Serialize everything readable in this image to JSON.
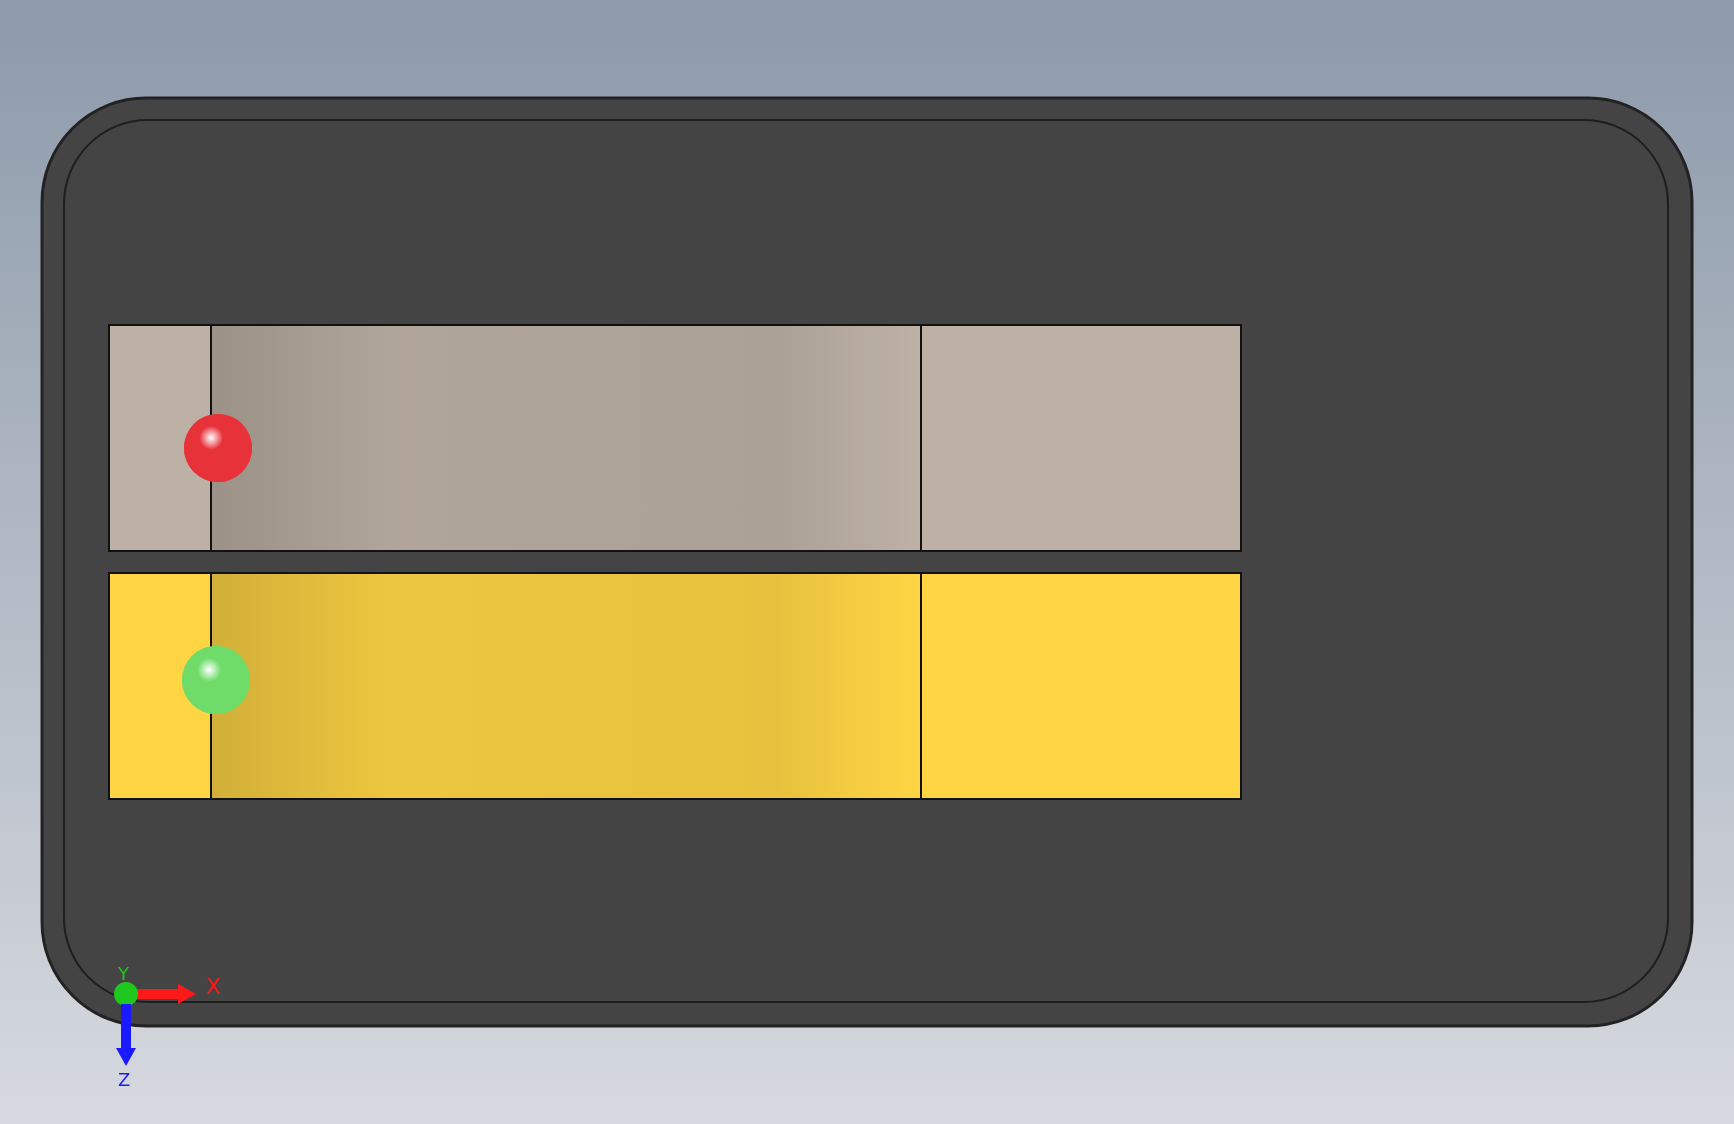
{
  "strips": [
    {
      "color": "#bdb1a5"
    },
    {
      "color": "#ffd544"
    }
  ],
  "markers": [
    {
      "color": "#e8323a"
    },
    {
      "color": "#6fdc6a"
    }
  ],
  "axes": [
    {
      "label": "X",
      "color": "#ff1a1a"
    },
    {
      "label": "Y",
      "color": "#1ec81e"
    },
    {
      "label": "Z",
      "color": "#1a1aff"
    }
  ]
}
